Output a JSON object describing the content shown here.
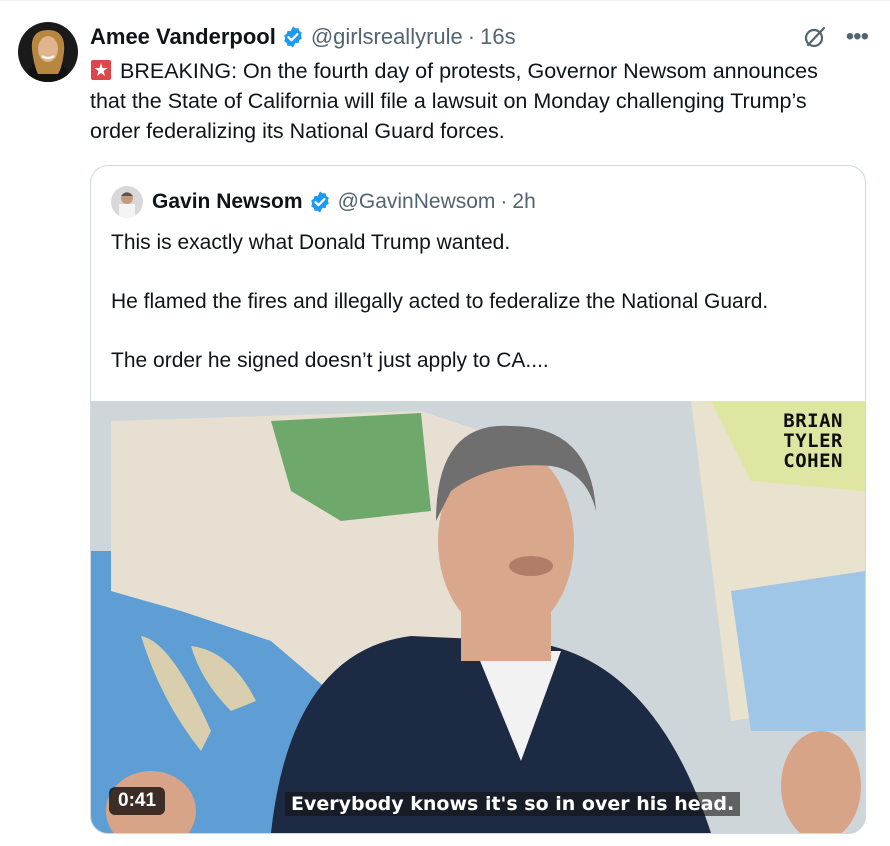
{
  "tweet": {
    "author_name": "Amee Vanderpool",
    "handle": "@girlsreallyrule",
    "separator": "·",
    "time": "16s",
    "text": "BREAKING: On the fourth day of protests, Governor Newsom announces that the State of California will file a lawsuit on Monday challenging Trump’s order federalizing its National Guard forces.",
    "icons": [
      "verified-badge-icon",
      "grok-icon",
      "more-icon",
      "siren-emoji-icon"
    ],
    "more_glyph": "•••"
  },
  "quoted_tweet": {
    "author_name": "Gavin Newsom",
    "handle": "@GavinNewsom",
    "separator": "·",
    "time": "2h",
    "paragraphs": [
      "This is exactly what Donald Trump wanted.",
      "He flamed the fires and illegally acted to federalize the National Guard.",
      "The order he signed doesn’t just apply to CA...."
    ],
    "video": {
      "duration": "0:41",
      "caption": "Everybody knows it's so in over his head.",
      "watermark_lines": [
        "BRIAN",
        "TYLER",
        "COHEN"
      ]
    }
  },
  "colors": {
    "text": "#0f1419",
    "secondary": "#536471",
    "verified": "#1d9bf0",
    "border": "#cfd9de"
  }
}
